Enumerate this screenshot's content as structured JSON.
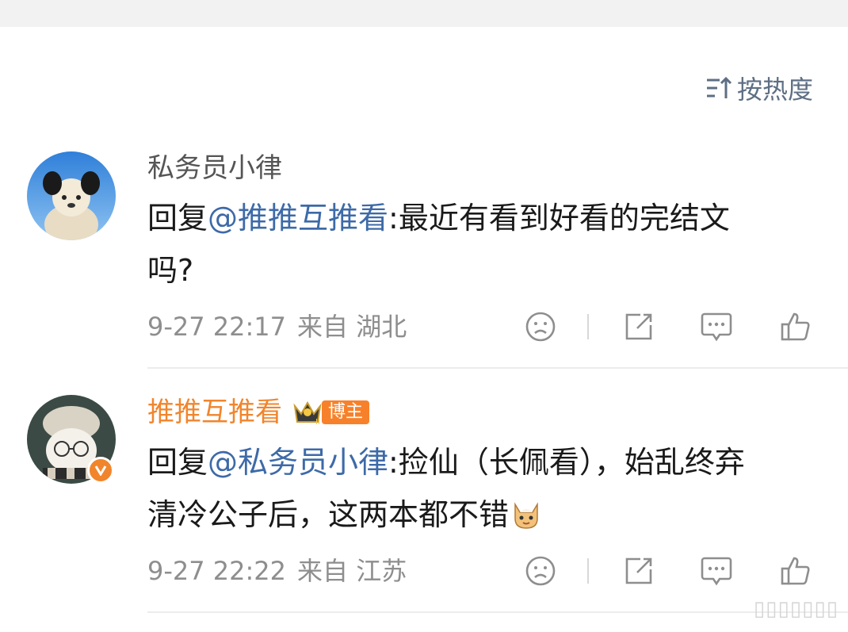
{
  "sort": {
    "label": "按热度",
    "icon": "sort-icon"
  },
  "comments": [
    {
      "username": "私务员小律",
      "prefix": "回复",
      "mention": "@推推互推看",
      "separator": ":",
      "text_line1": "最近有看到好看的完结文",
      "text_line2": "吗?",
      "date": "9-27 22:17",
      "source": "来自 湖北",
      "avatar_icon": "panda-plush-avatar"
    },
    {
      "username": "推推互推看",
      "role_tag": "博主",
      "prefix": "回复",
      "mention": "@私务员小律",
      "separator": ":",
      "text_line1": "捡仙（长佩看），始乱终弃",
      "text_line2": "清冷公子后，这两本都不错",
      "date": "9-27 22:22",
      "source": "来自 江苏",
      "avatar_icon": "cat-with-glasses-avatar"
    }
  ],
  "colors": {
    "mention": "#3d6aa8",
    "highlight_username": "#f1852c",
    "meta": "#8e8e8e",
    "sort": "#5e6f84"
  },
  "watermark": "▯▯▯▯▯▯▯"
}
